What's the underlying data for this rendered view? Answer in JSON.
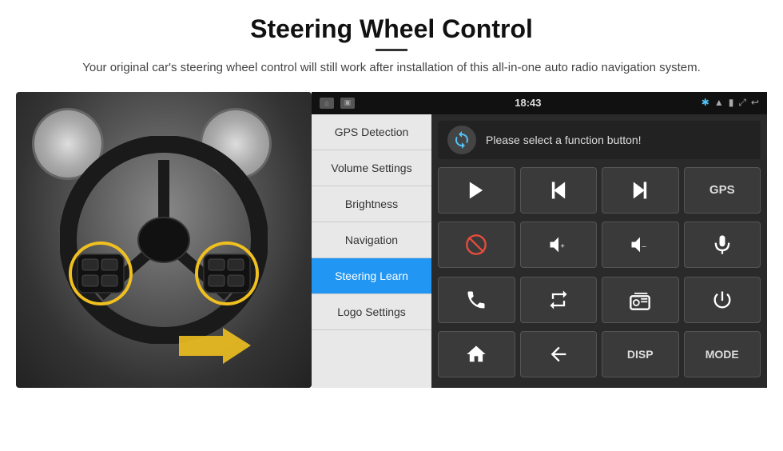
{
  "header": {
    "title": "Steering Wheel Control",
    "divider": true,
    "subtitle": "Your original car's steering wheel control will still work after installation of this all-in-one auto radio navigation system."
  },
  "statusBar": {
    "time": "18:43",
    "leftIcons": [
      "home",
      "screen"
    ],
    "rightIcons": [
      "bluetooth",
      "wifi",
      "battery",
      "expand",
      "back"
    ]
  },
  "menu": {
    "items": [
      {
        "label": "GPS Detection",
        "active": false
      },
      {
        "label": "Volume Settings",
        "active": false
      },
      {
        "label": "Brightness",
        "active": false
      },
      {
        "label": "Navigation",
        "active": false
      },
      {
        "label": "Steering Learn",
        "active": true
      },
      {
        "label": "Logo Settings",
        "active": false
      }
    ]
  },
  "panel": {
    "prompt": "Please select a function button!",
    "syncIcon": "↻",
    "buttons": [
      {
        "type": "play",
        "label": "▶"
      },
      {
        "type": "skip-back",
        "label": "⏮"
      },
      {
        "type": "skip-forward",
        "label": "⏭"
      },
      {
        "type": "gps",
        "label": "GPS"
      },
      {
        "type": "mute",
        "label": "⊘"
      },
      {
        "type": "vol-up",
        "label": "🔊+"
      },
      {
        "type": "vol-down",
        "label": "🔊-"
      },
      {
        "type": "mic",
        "label": "🎤"
      },
      {
        "type": "phone",
        "label": "📞"
      },
      {
        "type": "repeat",
        "label": "🔄"
      },
      {
        "type": "radio",
        "label": "📻"
      },
      {
        "type": "power",
        "label": "⏻"
      },
      {
        "type": "home",
        "label": "🏠"
      },
      {
        "type": "back",
        "label": "↩"
      },
      {
        "type": "disp",
        "label": "DISP"
      },
      {
        "type": "mode",
        "label": "MODE"
      }
    ]
  },
  "steeringWheel": {
    "leftBtns": [
      "+",
      "✆",
      "◂",
      "⋯"
    ],
    "rightBtns": [
      "≡",
      "◂",
      "○",
      "◇"
    ]
  }
}
